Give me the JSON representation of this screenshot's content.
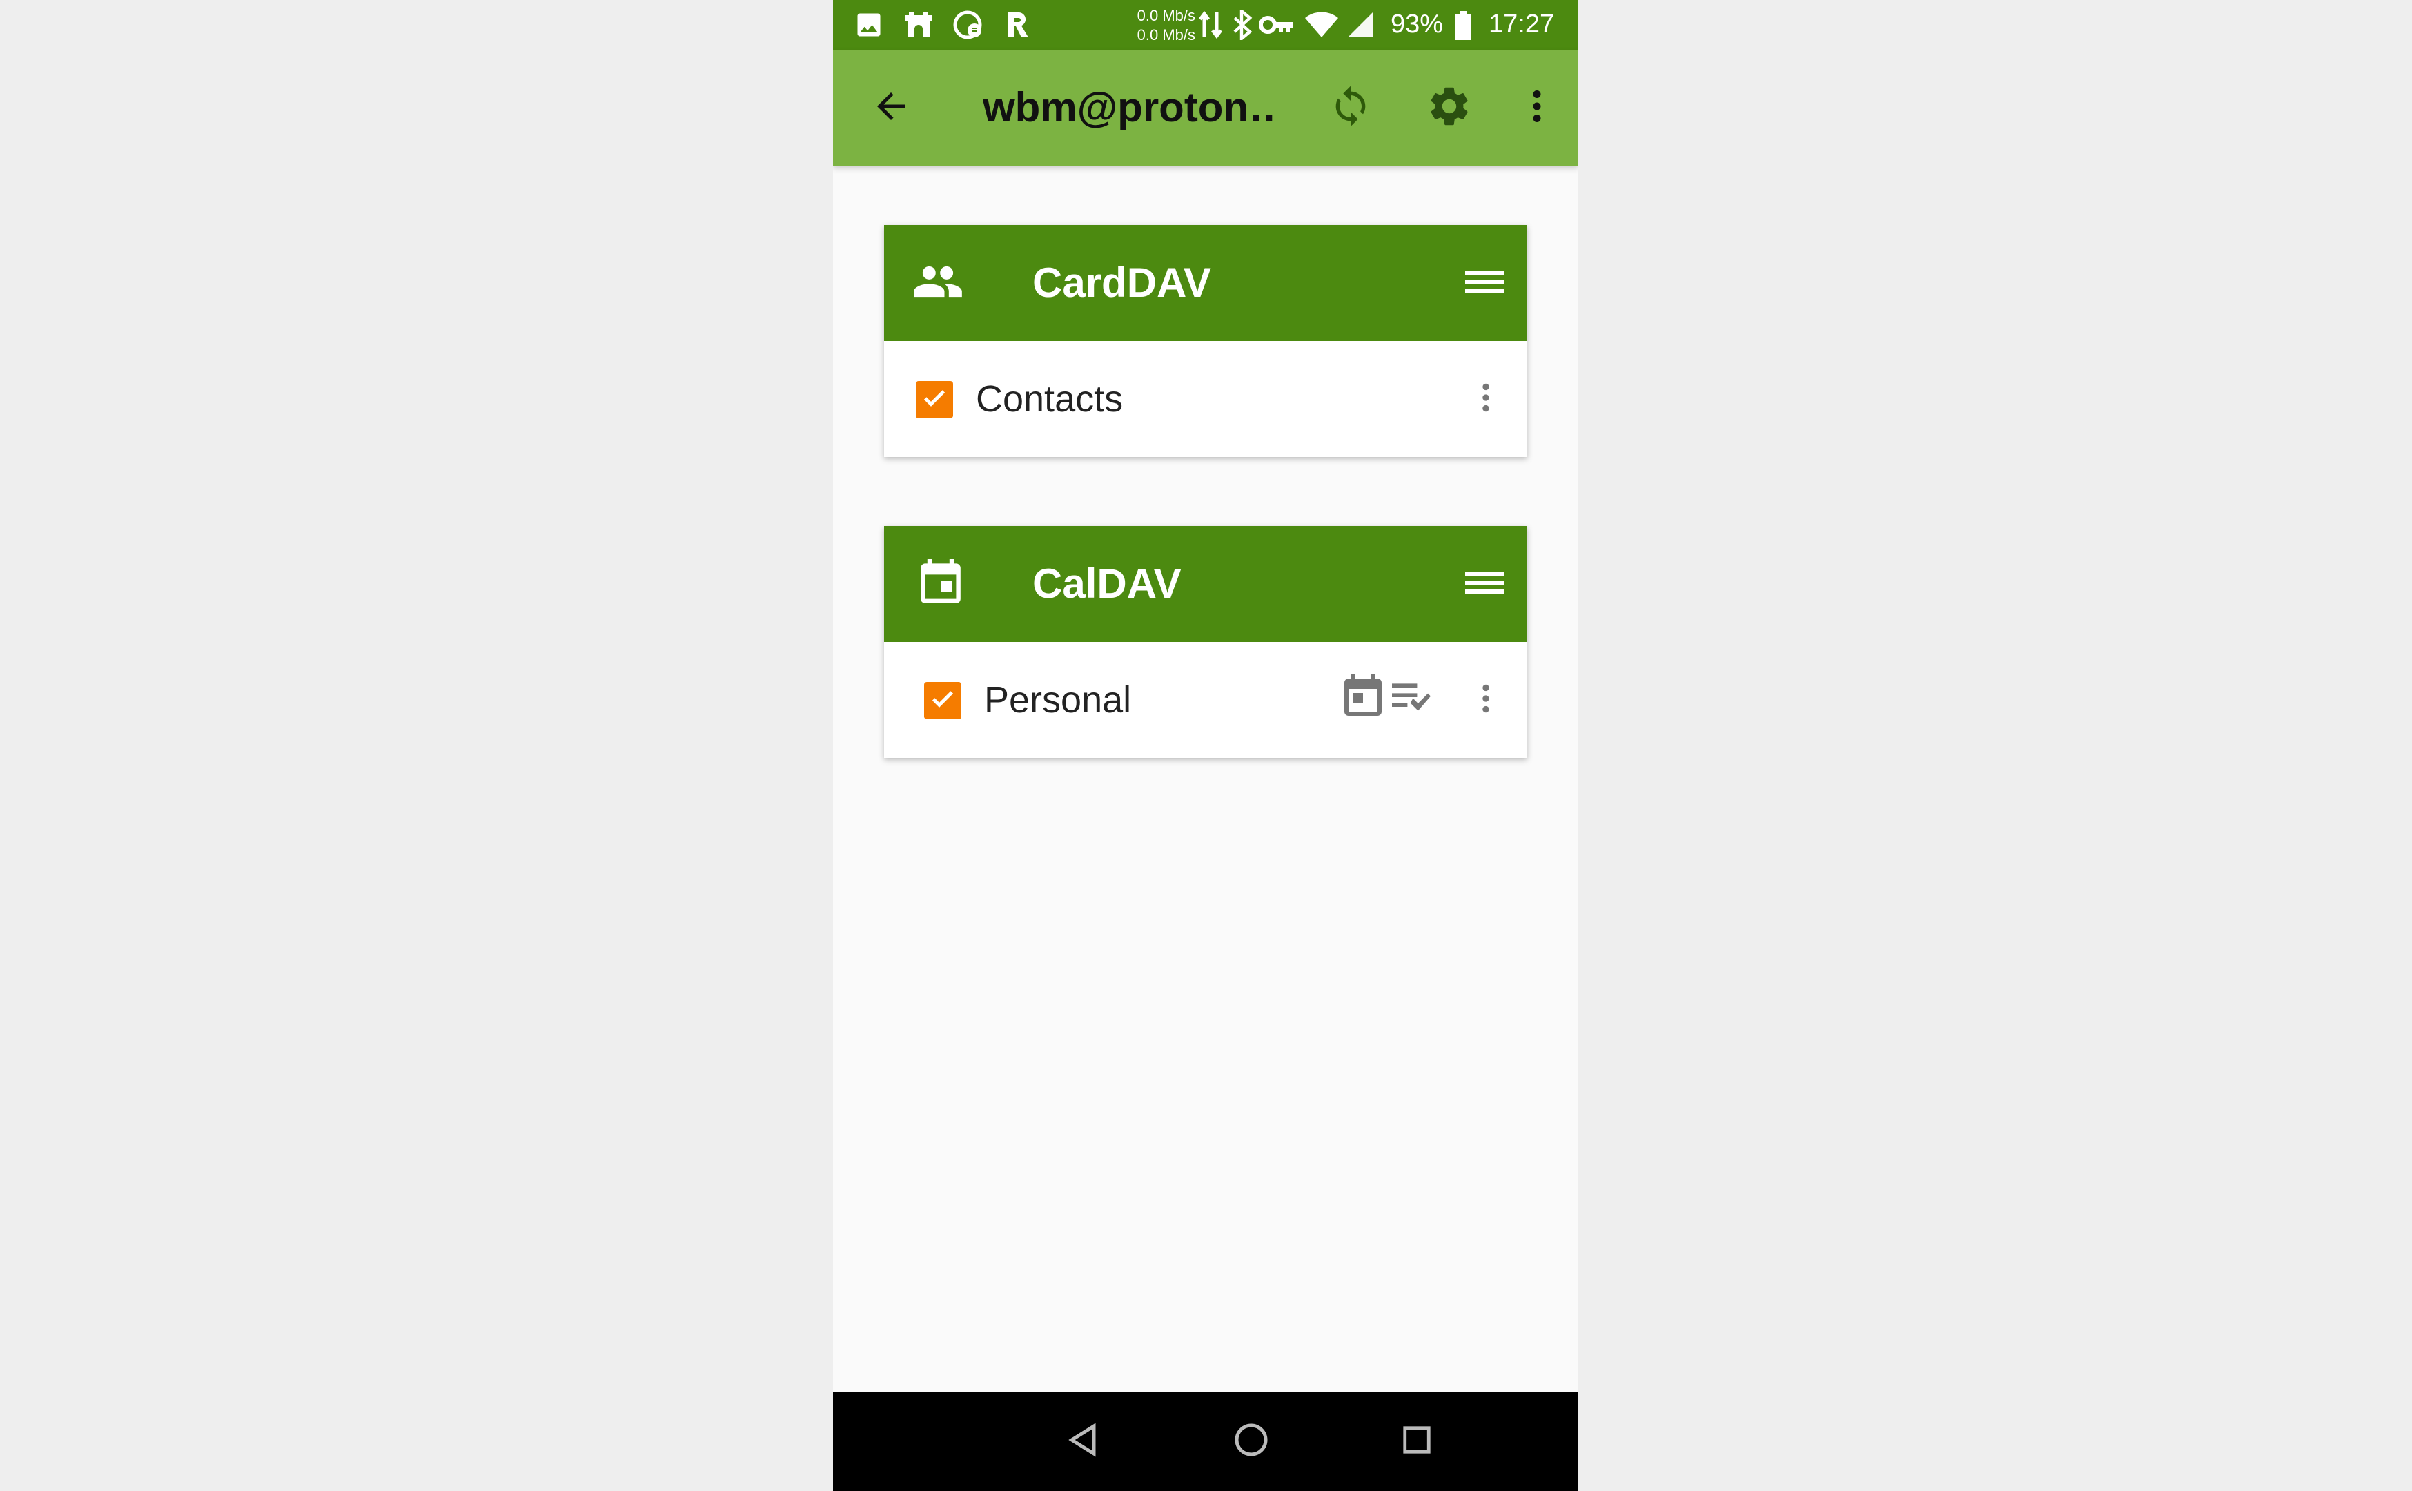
{
  "status_bar": {
    "net_up": "0.0 Mb/s",
    "net_down": "0.0 Mb/s",
    "battery": "93%",
    "time": "17:27",
    "icons": [
      "image-icon",
      "app-notification-icon",
      "sync-app-icon",
      "r-app-icon",
      "data-transfer-icon",
      "bluetooth-icon",
      "vpn-key-icon",
      "wifi-icon",
      "signal-icon",
      "battery-icon"
    ]
  },
  "toolbar": {
    "title": "wbm@proton…",
    "icons": [
      "back-arrow-icon",
      "sync-icon",
      "settings-gear-icon",
      "overflow-menu-icon"
    ]
  },
  "carddav": {
    "title": "CardDAV",
    "icon": "contacts-people-icon",
    "items": [
      {
        "label": "Contacts",
        "checked": true
      }
    ]
  },
  "caldav": {
    "title": "CalDAV",
    "icon": "calendar-icon",
    "items": [
      {
        "label": "Personal",
        "checked": true,
        "icons": [
          "calendar-event-icon",
          "task-list-icon"
        ]
      }
    ]
  },
  "nav": {
    "icons": [
      "back-triangle-icon",
      "home-circle-icon",
      "recents-square-icon"
    ]
  },
  "colors": {
    "status_bar": "#4c8a10",
    "toolbar": "#7cb342",
    "card_header": "#4c8a10",
    "checkbox": "#f57c00",
    "background": "#fafafa",
    "outer_background": "#eeeeee"
  }
}
